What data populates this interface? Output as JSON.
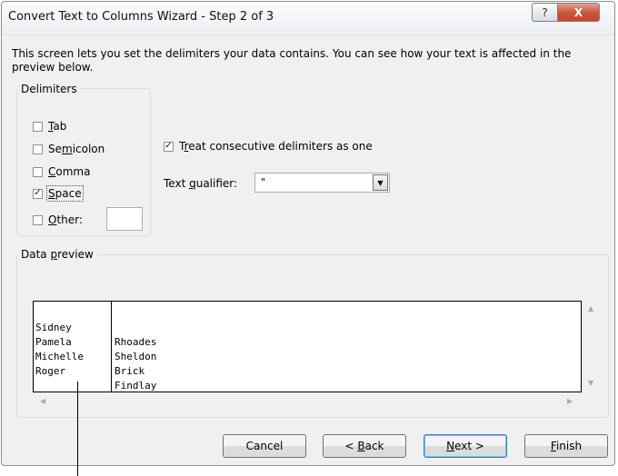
{
  "window": {
    "title": "Convert Text to Columns Wizard - Step 2 of 3",
    "help_label": "?",
    "close_label": "X"
  },
  "description": "This screen lets you set the delimiters your data contains.  You can see how your text is affected in the preview below.",
  "delimiters": {
    "legend": "Delimiters",
    "tab": {
      "pre": "",
      "key": "T",
      "post": "ab",
      "checked": false
    },
    "semicolon": {
      "pre": "Se",
      "key": "m",
      "post": "icolon",
      "checked": false
    },
    "comma": {
      "pre": "",
      "key": "C",
      "post": "omma",
      "checked": false
    },
    "space": {
      "pre": "",
      "key": "S",
      "post": "pace",
      "checked": true
    },
    "other": {
      "pre": "",
      "key": "O",
      "post": "ther:",
      "checked": false,
      "value": ""
    }
  },
  "consecutive": {
    "pre": "T",
    "key": "r",
    "post": "eat consecutive delimiters as one",
    "checked": true
  },
  "text_qualifier": {
    "pre": "Text ",
    "key": "q",
    "post": "ualifier:",
    "value": "\""
  },
  "data_preview": {
    "legend_pre": "Data ",
    "legend_key": "p",
    "legend_post": "review",
    "rows": [
      [
        "Sidney",
        "Rhoades"
      ],
      [
        "Pamela",
        "Sheldon"
      ],
      [
        "Michelle",
        "Brick"
      ],
      [
        "Roger",
        "Findlay"
      ]
    ]
  },
  "buttons": {
    "cancel": "Cancel",
    "back_pre": "< ",
    "back_key": "B",
    "back_post": "ack",
    "next_key": "N",
    "next_post": "ext >",
    "finish_key": "F",
    "finish_post": "inish"
  },
  "colors": {
    "accent": "#3c7fb1",
    "close": "#c2472d",
    "window_bg": "#f0f0f0"
  }
}
